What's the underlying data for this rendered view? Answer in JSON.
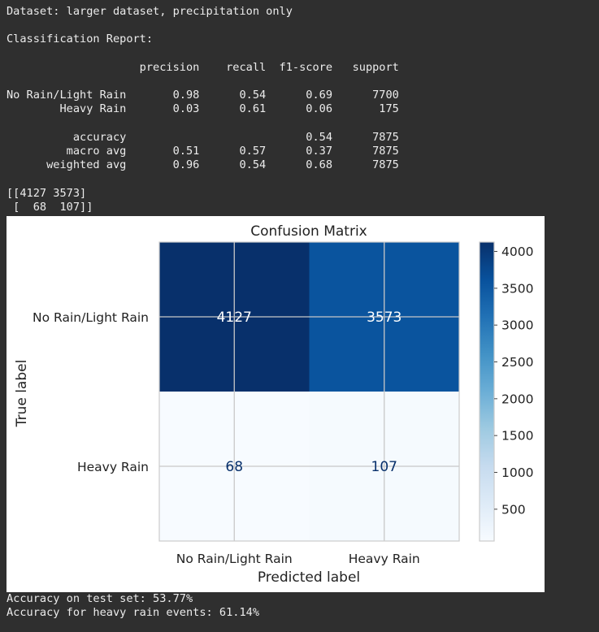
{
  "output_top": {
    "dataset_line": "Dataset: larger dataset, precipitation only",
    "report_heading": "Classification Report:",
    "report_columns": [
      "precision",
      "recall",
      "f1-score",
      "support"
    ],
    "report_rows": [
      {
        "label": "No Rain/Light Rain",
        "precision": "0.98",
        "recall": "0.54",
        "f1": "0.69",
        "support": "7700"
      },
      {
        "label": "Heavy Rain",
        "precision": "0.03",
        "recall": "0.61",
        "f1": "0.06",
        "support": "175"
      }
    ],
    "report_summary": [
      {
        "label": "accuracy",
        "precision": "",
        "recall": "",
        "f1": "0.54",
        "support": "7875"
      },
      {
        "label": "macro avg",
        "precision": "0.51",
        "recall": "0.57",
        "f1": "0.37",
        "support": "7875"
      },
      {
        "label": "weighted avg",
        "precision": "0.96",
        "recall": "0.54",
        "f1": "0.68",
        "support": "7875"
      }
    ],
    "matrix_lines": [
      "[[4127 3573]",
      " [  68  107]]"
    ]
  },
  "chart_data": {
    "type": "heatmap",
    "title": "Confusion Matrix",
    "xlabel": "Predicted label",
    "ylabel": "True label",
    "x_categories": [
      "No Rain/Light Rain",
      "Heavy Rain"
    ],
    "y_categories": [
      "No Rain/Light Rain",
      "Heavy Rain"
    ],
    "values": [
      [
        4127,
        3573
      ],
      [
        68,
        107
      ]
    ],
    "colormap": "Blues",
    "colorbar": {
      "min": 68,
      "max": 4127,
      "ticks": [
        500,
        1000,
        1500,
        2000,
        2500,
        3000,
        3500,
        4000
      ]
    },
    "grid": true,
    "text_dark": "#08306b",
    "text_light": "#ffffff"
  },
  "output_bottom": {
    "lines": [
      "Accuracy on test set: 53.77%",
      "Accuracy for heavy rain events: 61.14%"
    ]
  }
}
